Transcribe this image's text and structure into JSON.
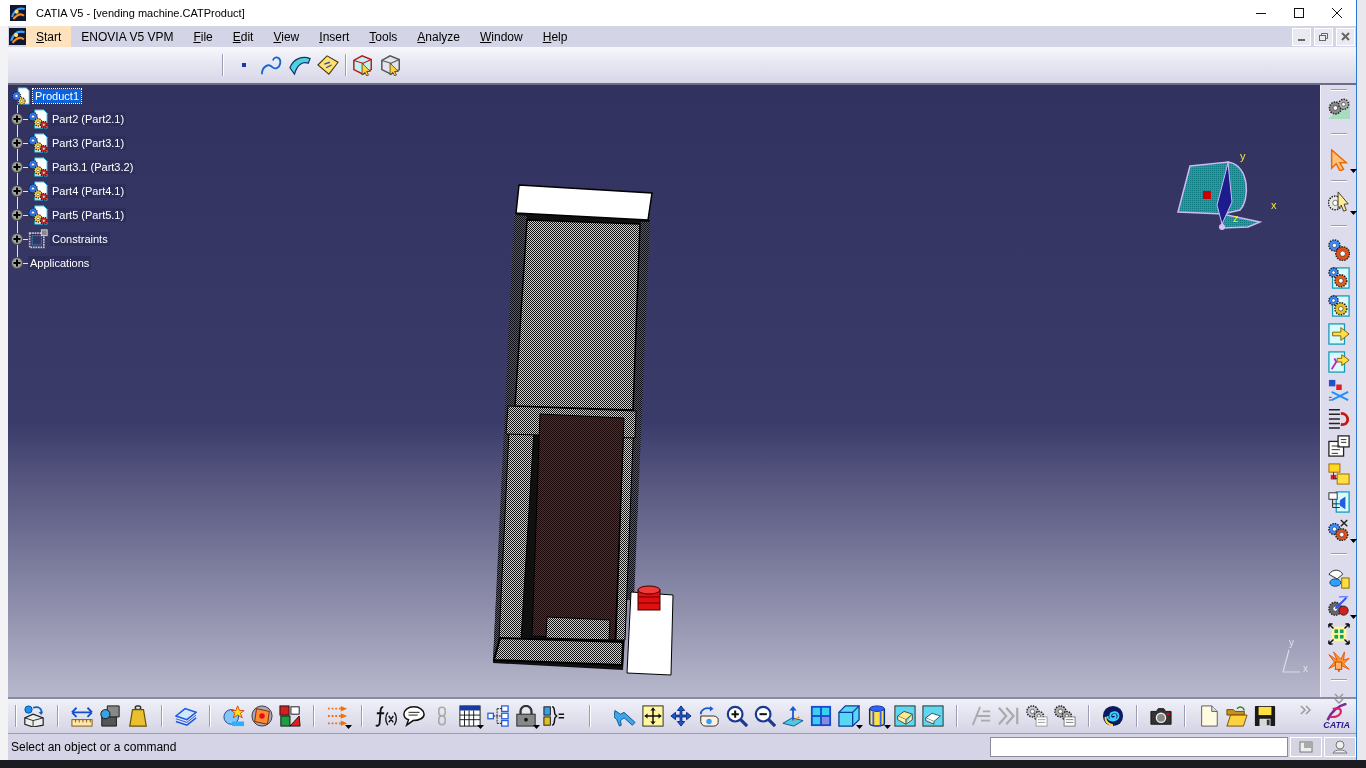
{
  "window": {
    "title": "CATIA V5 - [vending machine.CATProduct]"
  },
  "menu_bar": {
    "items": [
      {
        "label": "Start",
        "selected": true,
        "access_key": true
      },
      {
        "label": "ENOVIA V5 VPM",
        "selected": false,
        "access_key": false
      },
      {
        "label": "File",
        "selected": false,
        "access_key": true
      },
      {
        "label": "Edit",
        "selected": false,
        "access_key": true
      },
      {
        "label": "View",
        "selected": false,
        "access_key": true
      },
      {
        "label": "Insert",
        "selected": false,
        "access_key": true
      },
      {
        "label": "Tools",
        "selected": false,
        "access_key": true
      },
      {
        "label": "Analyze",
        "selected": false,
        "access_key": true
      },
      {
        "label": "Window",
        "selected": false,
        "access_key": true
      },
      {
        "label": "Help",
        "selected": false,
        "access_key": true
      }
    ]
  },
  "specification_tree": {
    "root": {
      "label": "Product1",
      "selected": true,
      "children": [
        {
          "kind": "part",
          "label": "Part2 (Part2.1)",
          "expanded": false,
          "selected": false
        },
        {
          "kind": "part",
          "label": "Part3 (Part3.1)",
          "expanded": false,
          "selected": false
        },
        {
          "kind": "part",
          "label": "Part3.1 (Part3.2)",
          "expanded": false,
          "selected": false
        },
        {
          "kind": "part",
          "label": "Part4 (Part4.1)",
          "expanded": false,
          "selected": false
        },
        {
          "kind": "part",
          "label": "Part5 (Part5.1)",
          "expanded": false,
          "selected": false
        },
        {
          "kind": "constraints",
          "label": "Constraints",
          "expanded": false,
          "selected": false
        },
        {
          "kind": "applications",
          "label": "Applications",
          "expanded": false,
          "selected": false
        }
      ]
    }
  },
  "compass": {
    "axis_labels": [
      "y",
      "x",
      "z"
    ]
  },
  "axis_triad": {
    "axis_labels": [
      "y",
      "x"
    ]
  },
  "brand_logo": {
    "text": "CATIA"
  },
  "status_bar": {
    "message": "Select an object or a command"
  }
}
